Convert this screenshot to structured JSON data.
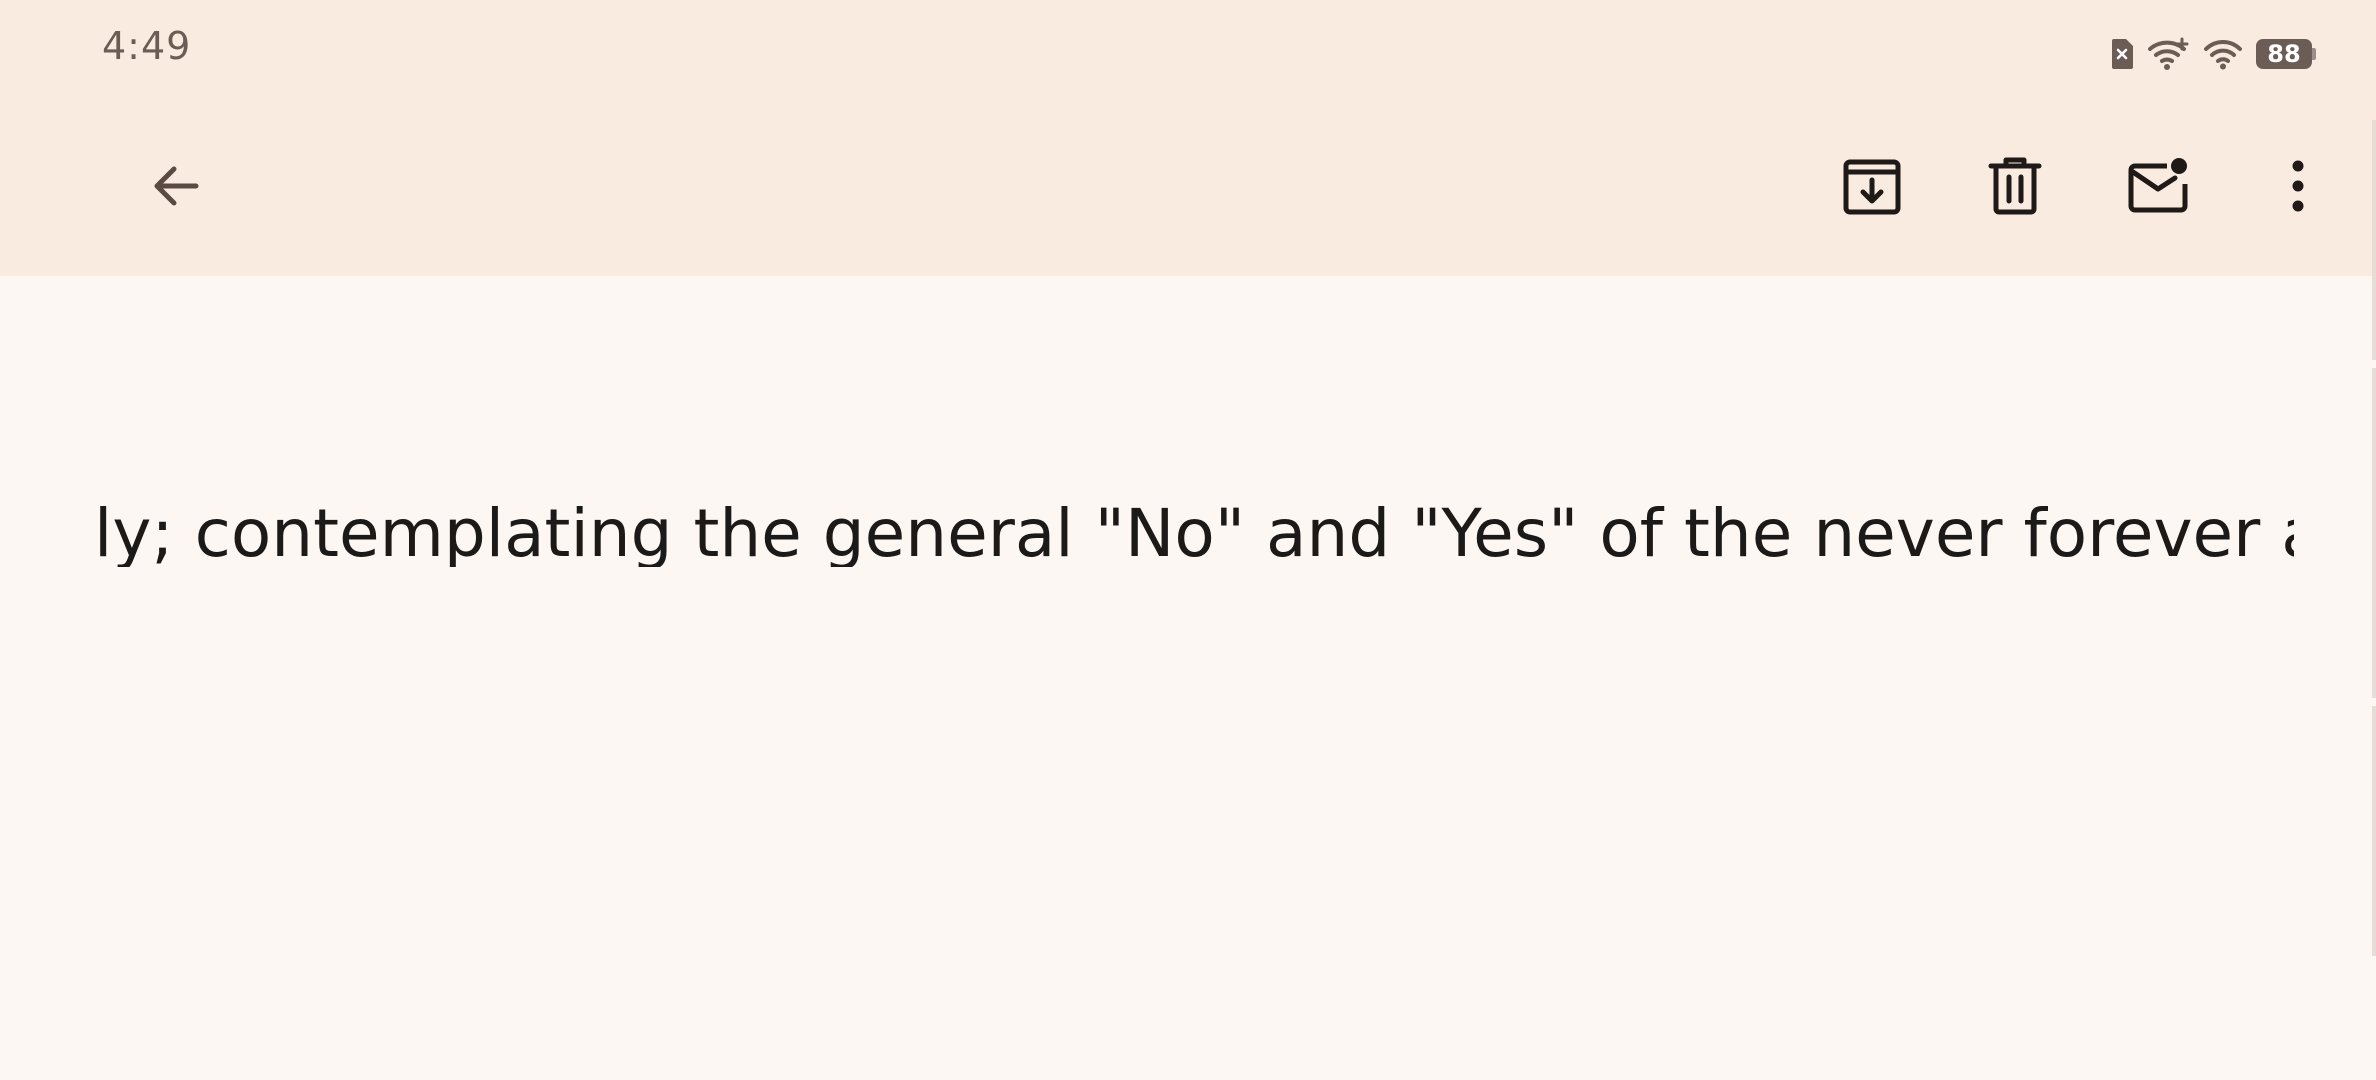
{
  "status_bar": {
    "time": "4:49",
    "battery_level": "88",
    "icons": [
      "sim-off-icon",
      "wifi-plus-icon",
      "wifi-icon",
      "battery-icon"
    ]
  },
  "toolbar": {
    "back_icon": "arrow-back-icon",
    "archive_icon": "archive-icon",
    "delete_icon": "delete-icon",
    "mark_unread_icon": "mark-unread-icon",
    "more_icon": "more-vert-icon"
  },
  "message": {
    "body_text": "ly; contemplating the general \"No\" and \"Yes\" of the never forever always"
  },
  "colors": {
    "header_background": "#f9ebe0",
    "content_background": "#fdf7f3",
    "icon_color": "#1f1a17",
    "text_color": "#1c1a19"
  }
}
